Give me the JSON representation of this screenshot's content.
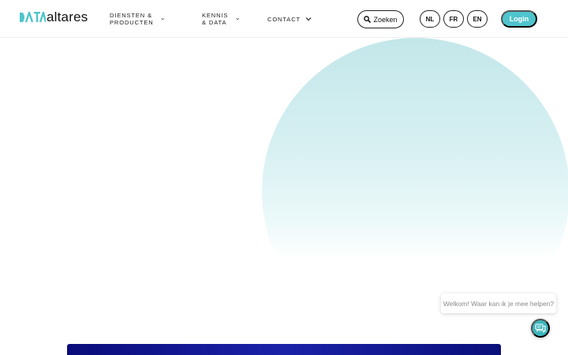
{
  "header": {
    "logo": {
      "wordmark": "altares",
      "mark_icon": "data-mark-icon",
      "brand_color": "#4fc4cc"
    },
    "nav": [
      {
        "label": "DIENSTEN & PRODUCTEN",
        "icon": "chevron-down-icon"
      },
      {
        "label": "KENNIS & DATA",
        "icon": "chevron-down-icon"
      },
      {
        "label": "CONTACT",
        "icon": "chevron-down-icon"
      }
    ],
    "search": {
      "label": "Zoeken",
      "icon": "search-icon"
    },
    "languages": [
      "NL",
      "FR",
      "EN"
    ],
    "login": {
      "label": "Login",
      "color": "#4fc4cc"
    }
  },
  "chat": {
    "prompt": "Welkom! Waar kan ik je mee helpen?",
    "launcher_icon": "chat-bubbles-icon",
    "color": "#3cb6bd"
  },
  "banner": {
    "color": "#0a0c7a"
  }
}
